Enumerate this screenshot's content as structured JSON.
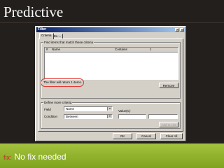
{
  "slide": {
    "title": "Predictive",
    "footer_tag": "fix:",
    "footer_text": "No fix needed"
  },
  "dialog": {
    "title": "Filter",
    "tabs": [
      {
        "label": "Criteria",
        "active": true
      },
      {
        "label": "Ex ...",
        "active": false
      }
    ],
    "criteria_group": {
      "label": "Find items that match these criteria",
      "columns": [
        "",
        "Name",
        "Contains",
        "J"
      ],
      "status_message": "The filter will return 1 items.",
      "remove_button": "Remove"
    },
    "define_group": {
      "label": "Define more criteria",
      "field_label": "Field",
      "field_value": "Name",
      "condition_label": "Condition",
      "condition_value": "Between",
      "values_label": "Value(s):",
      "add_button": "Add to List"
    },
    "buttons": {
      "ok": "OK",
      "cancel": "Cancel",
      "clear_all": "Clear All"
    },
    "colors": {
      "highlight": "#e53935",
      "footer": "#8db22e",
      "background": "#231f1c"
    }
  }
}
